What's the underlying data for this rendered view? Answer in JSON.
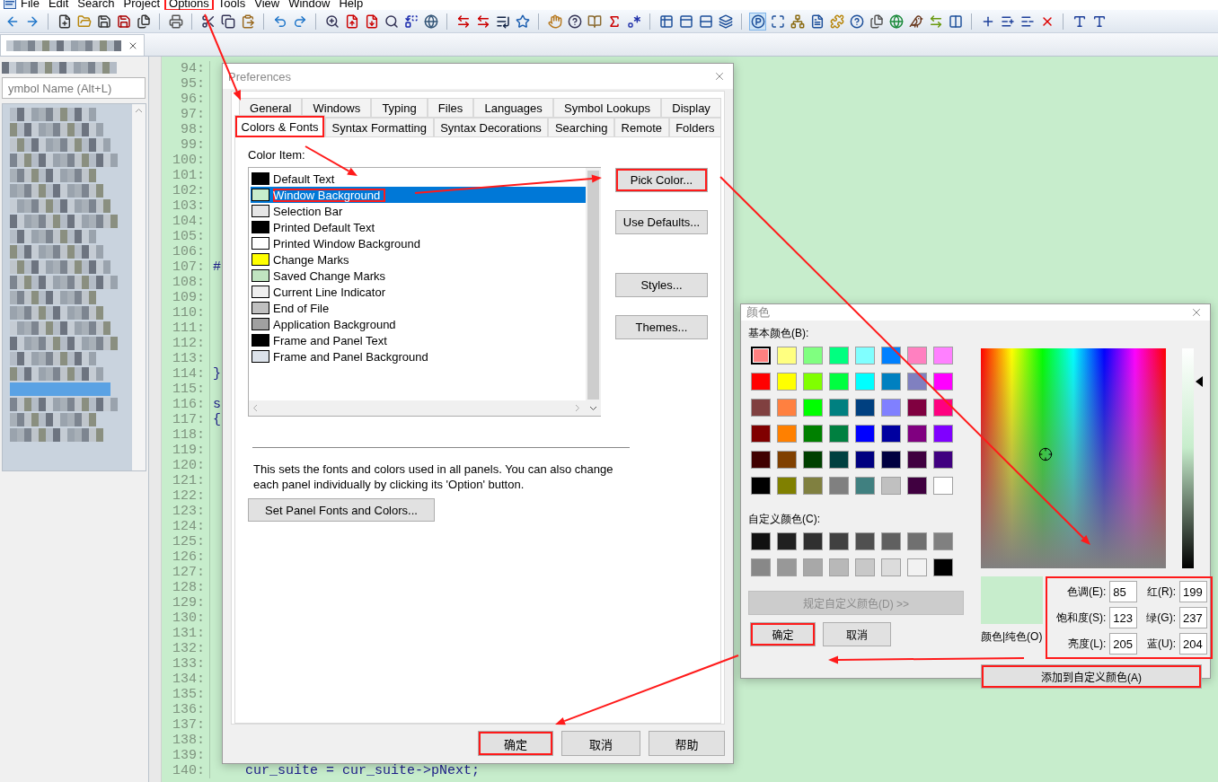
{
  "menu_bar": {
    "items": [
      {
        "label": "File",
        "highlighted": false
      },
      {
        "label": "Edit",
        "highlighted": false
      },
      {
        "label": "Search",
        "highlighted": false
      },
      {
        "label": "Project",
        "highlighted": false
      },
      {
        "label": "Options",
        "highlighted": true
      },
      {
        "label": "Tools",
        "highlighted": false
      },
      {
        "label": "View",
        "highlighted": false
      },
      {
        "label": "Window",
        "highlighted": false
      },
      {
        "label": "Help",
        "highlighted": false
      }
    ]
  },
  "symbol_panel": {
    "search": {
      "placeholder": "ymbol Name (Alt+L)"
    }
  },
  "editor": {
    "lines": [
      {
        "number": "94:"
      },
      {
        "number": "95:"
      },
      {
        "number": "96:"
      },
      {
        "number": "97:"
      },
      {
        "number": "98:"
      },
      {
        "number": "99:"
      },
      {
        "number": "100:"
      },
      {
        "number": "101:"
      },
      {
        "number": "102:"
      },
      {
        "number": "103:"
      },
      {
        "number": "104:"
      },
      {
        "number": "105:"
      },
      {
        "number": "106:"
      },
      {
        "number": "107:",
        "code": "#"
      },
      {
        "number": "108:"
      },
      {
        "number": "109:"
      },
      {
        "number": "110:"
      },
      {
        "number": "111:"
      },
      {
        "number": "112:"
      },
      {
        "number": "113:"
      },
      {
        "number": "114:",
        "code": "}"
      },
      {
        "number": "115:"
      },
      {
        "number": "116:",
        "code": "s"
      },
      {
        "number": "117:",
        "code": "{"
      },
      {
        "number": "118:"
      },
      {
        "number": "119:"
      },
      {
        "number": "120:"
      },
      {
        "number": "121:"
      },
      {
        "number": "122:"
      },
      {
        "number": "123:"
      },
      {
        "number": "124:"
      },
      {
        "number": "125:"
      },
      {
        "number": "126:"
      },
      {
        "number": "127:"
      },
      {
        "number": "128:"
      },
      {
        "number": "129:"
      },
      {
        "number": "130:"
      },
      {
        "number": "131:"
      },
      {
        "number": "132:"
      },
      {
        "number": "133:"
      },
      {
        "number": "134:"
      },
      {
        "number": "135:"
      },
      {
        "number": "136:"
      },
      {
        "number": "137:"
      },
      {
        "number": "138:"
      },
      {
        "number": "139:"
      },
      {
        "number": "140:",
        "code": "    cur_suite = cur_suite->pNext;"
      }
    ]
  },
  "preferences": {
    "title": "Preferences",
    "tab_rows": [
      {
        "tabs": [
          {
            "label": "General",
            "selected": false,
            "highlighted": false
          },
          {
            "label": "Windows",
            "selected": false,
            "highlighted": false
          },
          {
            "label": "Typing",
            "selected": false,
            "highlighted": false
          },
          {
            "label": "Files",
            "selected": false,
            "highlighted": false
          },
          {
            "label": "Languages",
            "selected": false,
            "highlighted": false
          },
          {
            "label": "Symbol Lookups",
            "selected": false,
            "highlighted": false
          },
          {
            "label": "Display",
            "selected": false,
            "highlighted": false
          }
        ]
      },
      {
        "tabs": [
          {
            "label": "Colors & Fonts",
            "selected": true,
            "highlighted": true
          },
          {
            "label": "Syntax Formatting",
            "selected": false,
            "highlighted": false
          },
          {
            "label": "Syntax Decorations",
            "selected": false,
            "highlighted": false
          },
          {
            "label": "Searching",
            "selected": false,
            "highlighted": false
          },
          {
            "label": "Remote",
            "selected": false,
            "highlighted": false
          },
          {
            "label": "Folders",
            "selected": false,
            "highlighted": false
          }
        ]
      }
    ],
    "color_item_label": "Color Item:",
    "color_items": [
      {
        "name": "Default Text",
        "color": "#000000",
        "selected": false,
        "highlighted": false
      },
      {
        "name": "Window Background",
        "color": "#c7edcc",
        "selected": true,
        "highlighted": true
      },
      {
        "name": "Selection Bar",
        "color": "#e6e6e6",
        "selected": false,
        "highlighted": false
      },
      {
        "name": "Printed Default Text",
        "color": "#000000",
        "selected": false,
        "highlighted": false
      },
      {
        "name": "Printed Window Background",
        "color": "#ffffff",
        "selected": false,
        "highlighted": false
      },
      {
        "name": "Change Marks",
        "color": "#ffff00",
        "selected": false,
        "highlighted": false
      },
      {
        "name": "Saved Change Marks",
        "color": "#c0e4c0",
        "selected": false,
        "highlighted": false
      },
      {
        "name": "Current Line Indicator",
        "color": "#eeeeee",
        "selected": false,
        "highlighted": false
      },
      {
        "name": "End of File",
        "color": "#c0c0c0",
        "selected": false,
        "highlighted": false
      },
      {
        "name": "Application Background",
        "color": "#a0a0a0",
        "selected": false,
        "highlighted": false
      },
      {
        "name": "Frame and Panel Text",
        "color": "#000000",
        "selected": false,
        "highlighted": false
      },
      {
        "name": "Frame and Panel Background",
        "color": "#dce2ea",
        "selected": false,
        "highlighted": false
      }
    ],
    "side_buttons": [
      {
        "label": "Pick Color...",
        "highlighted": true
      },
      {
        "label": "Use Defaults...",
        "highlighted": false
      },
      {
        "label": "Styles...",
        "highlighted": false
      },
      {
        "label": "Themes...",
        "highlighted": false
      }
    ],
    "note": "This sets the fonts and colors used in all panels. You can also change each panel individually by clicking its 'Option' button.",
    "panel_button": "Set Panel Fonts and Colors...",
    "footer_buttons": [
      {
        "label": "确定",
        "highlighted": true
      },
      {
        "label": "取消",
        "highlighted": false
      },
      {
        "label": "帮助",
        "highlighted": false
      }
    ]
  },
  "color_dialog": {
    "title": "颜色",
    "basic_label": "基本颜色(B):",
    "basic_colors": [
      {
        "color": "#ff8080",
        "selected": true
      },
      {
        "color": "#ffff80",
        "selected": false
      },
      {
        "color": "#80ff80",
        "selected": false
      },
      {
        "color": "#00ff80",
        "selected": false
      },
      {
        "color": "#80ffff",
        "selected": false
      },
      {
        "color": "#0080ff",
        "selected": false
      },
      {
        "color": "#ff80c0",
        "selected": false
      },
      {
        "color": "#ff80ff",
        "selected": false
      },
      {
        "color": "#ff0000",
        "selected": false
      },
      {
        "color": "#ffff00",
        "selected": false
      },
      {
        "color": "#80ff00",
        "selected": false
      },
      {
        "color": "#00ff40",
        "selected": false
      },
      {
        "color": "#00ffff",
        "selected": false
      },
      {
        "color": "#0080c0",
        "selected": false
      },
      {
        "color": "#8080c0",
        "selected": false
      },
      {
        "color": "#ff00ff",
        "selected": false
      },
      {
        "color": "#804040",
        "selected": false
      },
      {
        "color": "#ff8040",
        "selected": false
      },
      {
        "color": "#00ff00",
        "selected": false
      },
      {
        "color": "#008080",
        "selected": false
      },
      {
        "color": "#004080",
        "selected": false
      },
      {
        "color": "#8080ff",
        "selected": false
      },
      {
        "color": "#800040",
        "selected": false
      },
      {
        "color": "#ff0080",
        "selected": false
      },
      {
        "color": "#800000",
        "selected": false
      },
      {
        "color": "#ff8000",
        "selected": false
      },
      {
        "color": "#008000",
        "selected": false
      },
      {
        "color": "#008040",
        "selected": false
      },
      {
        "color": "#0000ff",
        "selected": false
      },
      {
        "color": "#0000a0",
        "selected": false
      },
      {
        "color": "#800080",
        "selected": false
      },
      {
        "color": "#8000ff",
        "selected": false
      },
      {
        "color": "#400000",
        "selected": false
      },
      {
        "color": "#804000",
        "selected": false
      },
      {
        "color": "#004000",
        "selected": false
      },
      {
        "color": "#004040",
        "selected": false
      },
      {
        "color": "#000080",
        "selected": false
      },
      {
        "color": "#000040",
        "selected": false
      },
      {
        "color": "#400040",
        "selected": false
      },
      {
        "color": "#400080",
        "selected": false
      },
      {
        "color": "#000000",
        "selected": false
      },
      {
        "color": "#808000",
        "selected": false
      },
      {
        "color": "#808040",
        "selected": false
      },
      {
        "color": "#808080",
        "selected": false
      },
      {
        "color": "#408080",
        "selected": false
      },
      {
        "color": "#c0c0c0",
        "selected": false
      },
      {
        "color": "#400040",
        "selected": false
      },
      {
        "color": "#ffffff",
        "selected": false
      }
    ],
    "custom_label": "自定义颜色(C):",
    "custom_colors": [
      {
        "color": "#111111"
      },
      {
        "color": "#202020"
      },
      {
        "color": "#303030"
      },
      {
        "color": "#404040"
      },
      {
        "color": "#505050"
      },
      {
        "color": "#606060"
      },
      {
        "color": "#707070"
      },
      {
        "color": "#808080"
      },
      {
        "color": "#888888"
      },
      {
        "color": "#989898"
      },
      {
        "color": "#a8a8a8"
      },
      {
        "color": "#b8b8b8"
      },
      {
        "color": "#c8c8c8"
      },
      {
        "color": "#dcdcdc"
      },
      {
        "color": "#f2f2f2"
      },
      {
        "color": "#000000"
      }
    ],
    "define_button": {
      "label": "规定自定义颜色(D) >>",
      "disabled": true
    },
    "ok_button": {
      "label": "确定",
      "highlighted": true
    },
    "cancel_button": {
      "label": "取消",
      "highlighted": false
    },
    "luminance": {
      "level": 0.85
    },
    "preview": {
      "color": "#c7edcc"
    },
    "preview_label": "颜色|纯色(O)",
    "fields_highlighted": true,
    "fields": [
      {
        "label": "色调(E):",
        "value": "85"
      },
      {
        "label": "红(R):",
        "value": "199"
      },
      {
        "label": "饱和度(S):",
        "value": "123"
      },
      {
        "label": "绿(G):",
        "value": "237"
      },
      {
        "label": "亮度(L):",
        "value": "205"
      },
      {
        "label": "蓝(U):",
        "value": "204"
      }
    ],
    "add_button": {
      "label": "添加到自定义颜色(A)",
      "highlighted": true
    }
  }
}
